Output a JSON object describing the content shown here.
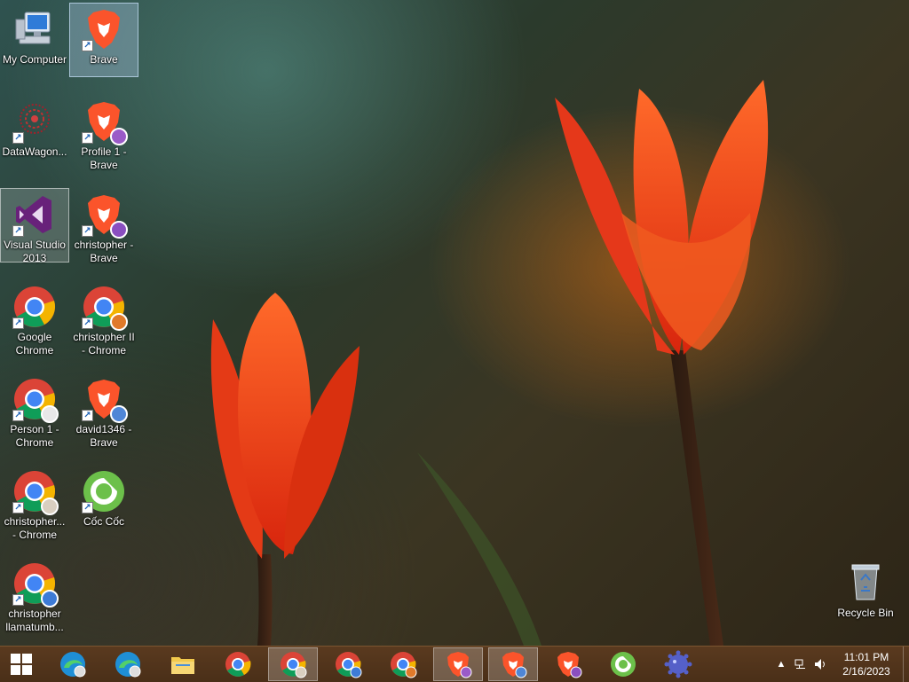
{
  "desktop": {
    "icons": [
      {
        "label": "My Computer",
        "icon": "computer-icon"
      },
      {
        "label": "Brave",
        "icon": "brave-icon"
      },
      {
        "label": "DataWagon...",
        "icon": "datawagon-icon"
      },
      {
        "label": "Profile 1 -\nBrave",
        "icon": "brave-profile-icon"
      },
      {
        "label": "Visual Studio\n2013",
        "icon": "visual-studio-icon"
      },
      {
        "label": "christopher -\nBrave",
        "icon": "brave-profile-icon"
      },
      {
        "label": "Google\nChrome",
        "icon": "chrome-icon"
      },
      {
        "label": "christopher II\n- Chrome",
        "icon": "chrome-profile-icon"
      },
      {
        "label": "Person 1 -\nChrome",
        "icon": "chrome-person-icon"
      },
      {
        "label": "david1346 -\nBrave",
        "icon": "brave-profile-icon"
      },
      {
        "label": "christopher...\n- Chrome",
        "icon": "chrome-profile-icon"
      },
      {
        "label": "Cốc Cốc",
        "icon": "coccoc-icon"
      },
      {
        "label": "christopher\nllamatumb...",
        "icon": "chrome-profile-icon"
      },
      {
        "label": "Recycle Bin",
        "icon": "recycle-bin-icon"
      }
    ]
  },
  "taskbar": {
    "items": [
      {
        "icon": "edge-profile-icon"
      },
      {
        "icon": "edge-profile-icon"
      },
      {
        "icon": "file-explorer-icon"
      },
      {
        "icon": "chrome-icon"
      },
      {
        "icon": "chrome-profile-icon",
        "active": true
      },
      {
        "icon": "chrome-profile-icon"
      },
      {
        "icon": "chrome-profile-icon"
      },
      {
        "icon": "brave-profile-icon",
        "active": true
      },
      {
        "icon": "brave-profile-icon",
        "active": true
      },
      {
        "icon": "brave-profile-icon"
      },
      {
        "icon": "coccoc-icon"
      },
      {
        "icon": "ms-paint-icon"
      }
    ],
    "tray": {
      "chevron": "▲",
      "time": "11:01 PM",
      "date": "2/16/2023"
    }
  },
  "colors": {
    "chrome_red": "#db4437",
    "chrome_yellow": "#f4b400",
    "chrome_green": "#0f9d58",
    "chrome_blue": "#4285f4",
    "brave_orange": "#fb542b",
    "vs_purple": "#68217a",
    "coccoc_green": "#6cc04a",
    "taskbar": "#5a3a1f"
  }
}
